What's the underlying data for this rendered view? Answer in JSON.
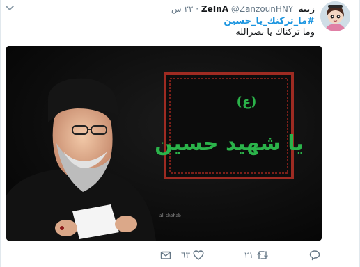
{
  "tweet": {
    "display_name": "زينة ZeInA",
    "handle": "@ZanzounHNY",
    "separator": "·",
    "time": "٢٢ س",
    "hashtag": "#ما_تركنك_يا_حسين",
    "text": "وما تركناك يا نصرالله"
  },
  "image": {
    "banner_text": "يا شهيد حسين",
    "banner_sign": "(ع)",
    "watermark": "ali shehab",
    "banner_border_color": "#c0392b",
    "banner_text_color": "#2bb34a"
  },
  "actions": {
    "reply_count": "",
    "retweet_count": "٢١",
    "like_count": "٦٣",
    "dm_count": ""
  },
  "icons": {
    "caret": "chevron-down-icon",
    "reply": "reply-icon",
    "retweet": "retweet-icon",
    "like": "heart-icon",
    "dm": "envelope-icon"
  },
  "colors": {
    "link": "#1b95e0",
    "muted": "#657786",
    "text": "#14171a"
  }
}
